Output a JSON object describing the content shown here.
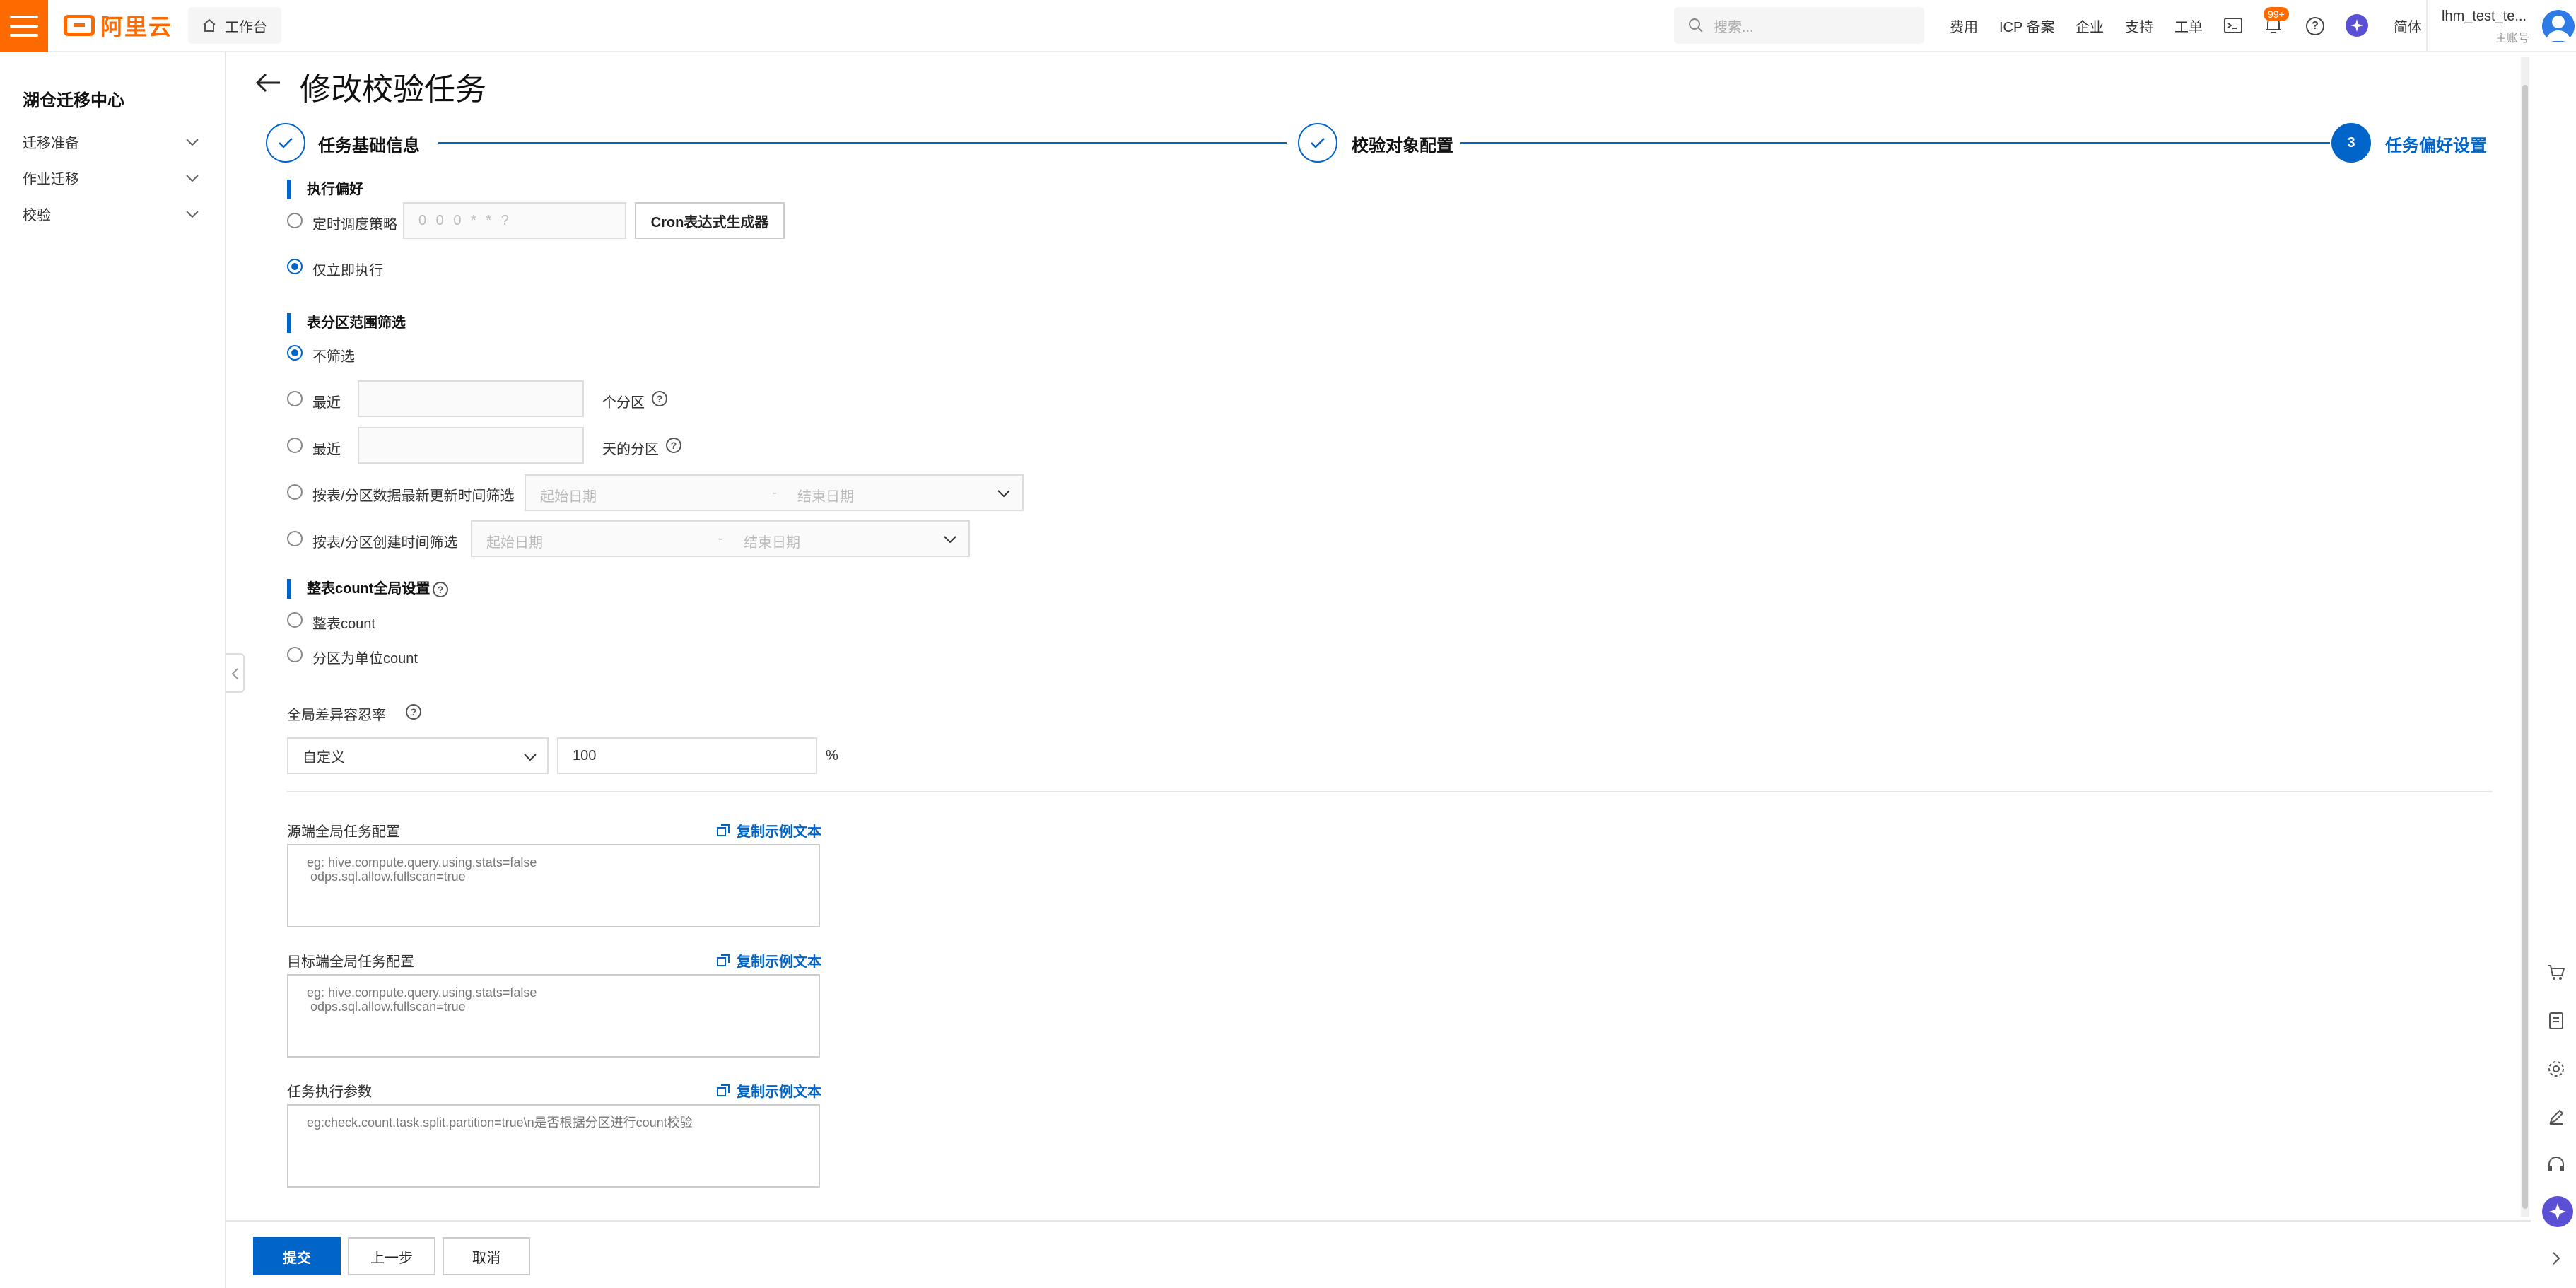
{
  "header": {
    "logo_text": "阿里云",
    "workbench": "工作台",
    "search_placeholder": "搜索...",
    "nav": [
      "费用",
      "ICP 备案",
      "企业",
      "支持",
      "工单"
    ],
    "notification_badge": "99+",
    "language": "简体",
    "user_name": "lhm_test_te...",
    "user_role": "主账号"
  },
  "sidebar": {
    "title": "湖仓迁移中心",
    "items": [
      {
        "label": "迁移准备"
      },
      {
        "label": "作业迁移"
      },
      {
        "label": "校验"
      }
    ]
  },
  "page": {
    "title": "修改校验任务"
  },
  "steps": [
    {
      "label": "任务基础信息",
      "state": "done"
    },
    {
      "label": "校验对象配置",
      "state": "done"
    },
    {
      "label": "任务偏好设置",
      "state": "active",
      "number": "3"
    }
  ],
  "exec_pref": {
    "title": "执行偏好",
    "schedule_label": "定时调度策略",
    "cron_placeholder": "0 0 0 * * ?",
    "cron_button": "Cron表达式生成器",
    "immediate_label": "仅立即执行",
    "selected": "immediate"
  },
  "partition_filter": {
    "title": "表分区范围筛选",
    "no_filter": "不筛选",
    "recent_label_1": "最近",
    "recent_suffix_1": "个分区",
    "recent_label_2": "最近",
    "recent_suffix_2": "天的分区",
    "update_time_label": "按表/分区数据最新更新时间筛选",
    "create_time_label": "按表/分区创建时间筛选",
    "start_date": "起始日期",
    "end_date": "结束日期",
    "range_sep": "-",
    "selected": "none"
  },
  "count_setting": {
    "title": "整表count全局设置",
    "whole_table": "整表count",
    "by_partition": "分区为单位count",
    "tolerance_label": "全局差异容忍率",
    "tolerance_mode": "自定义",
    "tolerance_value": "100",
    "tolerance_unit": "%"
  },
  "configs": {
    "copy_text": "复制示例文本",
    "source_label": "源端全局任务配置",
    "source_placeholder": "eg: hive.compute.query.using.stats=false\n odps.sql.allow.fullscan=true",
    "target_label": "目标端全局任务配置",
    "target_placeholder": "eg: hive.compute.query.using.stats=false\n odps.sql.allow.fullscan=true",
    "params_label": "任务执行参数",
    "params_placeholder": "eg:check.count.task.split.partition=true\\n是否根据分区进行count校验"
  },
  "footer": {
    "submit": "提交",
    "prev": "上一步",
    "cancel": "取消"
  },
  "colors": {
    "brand": "#ff6a00",
    "primary": "#0064c8"
  }
}
